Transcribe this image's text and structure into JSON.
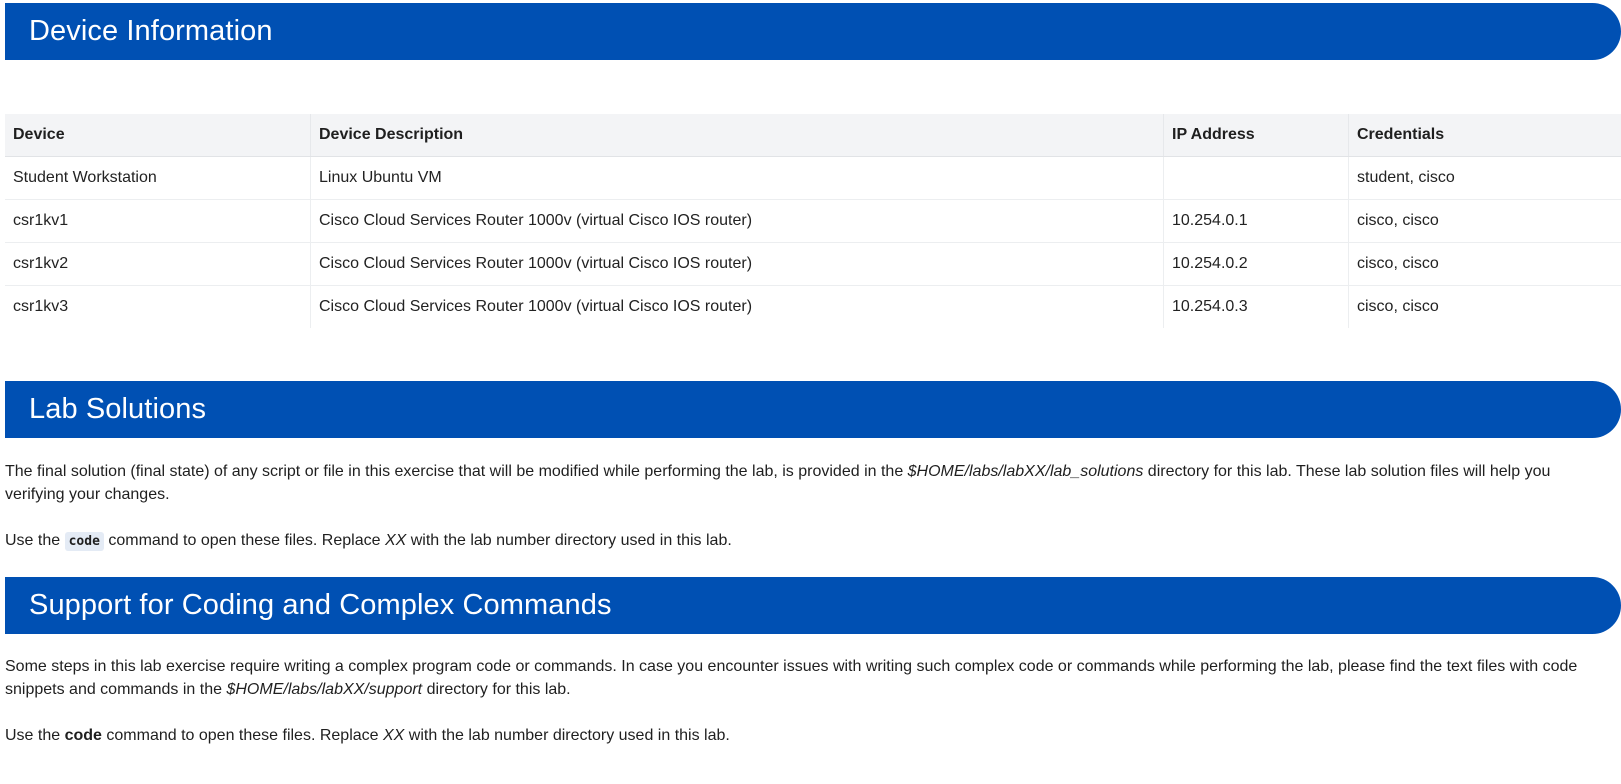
{
  "sections": {
    "device_information": {
      "title": "Device Information",
      "table": {
        "headers": [
          "Device",
          "Device Description",
          "IP Address",
          "Credentials"
        ],
        "rows": [
          [
            "Student Workstation",
            "Linux Ubuntu VM",
            "",
            "student, cisco"
          ],
          [
            "csr1kv1",
            "Cisco Cloud Services Router 1000v (virtual Cisco IOS router)",
            "10.254.0.1",
            "cisco, cisco"
          ],
          [
            "csr1kv2",
            "Cisco Cloud Services Router 1000v (virtual Cisco IOS router)",
            "10.254.0.2",
            "cisco, cisco"
          ],
          [
            "csr1kv3",
            "Cisco Cloud Services Router 1000v (virtual Cisco IOS router)",
            "10.254.0.3",
            "cisco, cisco"
          ]
        ]
      }
    },
    "lab_solutions": {
      "title": "Lab Solutions",
      "p1": {
        "before": "The final solution (final state) of any script or file in this exercise that will be modified while performing the lab, is provided in the ",
        "path": "$HOME/labs/labXX/lab_solutions",
        "after": " directory for this lab. These lab solution files will help you verifying your changes."
      },
      "p2": {
        "before": "Use the ",
        "code": "code",
        "middle": " command to open these files. Replace ",
        "xx": "XX",
        "after": " with the lab number directory used in this lab."
      }
    },
    "support": {
      "title": "Support for Coding and Complex Commands",
      "p1": {
        "before": "Some steps in this lab exercise require writing a complex program code or commands. In case you encounter issues with writing such complex code or commands while performing the lab, please find the text files with code snippets and commands in the ",
        "path": "$HOME/labs/labXX/support",
        "after": " directory for this lab."
      },
      "p2": {
        "before": "Use the ",
        "code": "code",
        "middle": " command to open these files. Replace ",
        "xx": "XX",
        "after": " with the lab number directory used in this lab."
      }
    }
  },
  "colors": {
    "banner_blue": "#0050b3",
    "table_header_bg": "#f3f4f6",
    "inline_code_bg": "#e4ebf5"
  }
}
